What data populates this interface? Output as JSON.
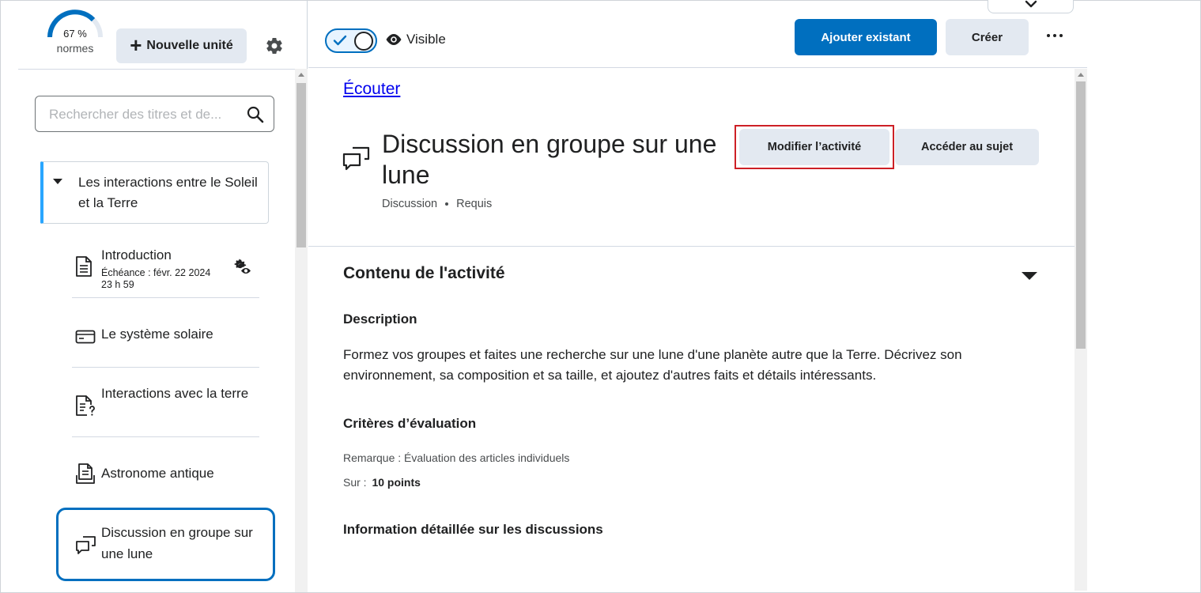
{
  "progress": {
    "percent_text": "67 %",
    "label": "normes",
    "fraction": 0.67
  },
  "toolbar_left": {
    "new_unit_label": "Nouvelle unité"
  },
  "search": {
    "placeholder": "Rechercher des titres et de..."
  },
  "unit": {
    "title": "Les interactions entre le Soleil et la Terre"
  },
  "toc": {
    "items": [
      {
        "title": "Introduction",
        "sub1": "Échéance : févr. 22 2024",
        "sub2": "23 h 59",
        "icon": "document-icon"
      },
      {
        "title": "Le système solaire",
        "icon": "card-icon"
      },
      {
        "title": "Interactions avec la terre",
        "icon": "quiz-icon"
      },
      {
        "title": "Astronome antique",
        "icon": "assignment-icon"
      },
      {
        "title": "Discussion en groupe sur une lune",
        "icon": "discussion-icon"
      }
    ]
  },
  "topbar": {
    "visibility_label": "Visible",
    "visibility_on": true,
    "add_existing_label": "Ajouter existant",
    "create_label": "Créer"
  },
  "activity": {
    "listen_link": "Écouter",
    "title": "Discussion en groupe sur une lune",
    "type": "Discussion",
    "requirement": "Requis",
    "edit_label": "Modifier l’activité",
    "goto_label": "Accéder au sujet"
  },
  "details": {
    "section_title": "Contenu de l'activité",
    "description_heading": "Description",
    "description_text": "Formez vos groupes et faites une recherche sur une lune d'une planète autre que la Terre. Décrivez son environnement, sa composition et sa taille, et ajoutez d'autres faits et détails intéressants.",
    "criteria_heading": "Critères d’évaluation",
    "remark": "Remarque : Évaluation des articles individuels",
    "out_of_label": "Sur :",
    "out_of_value": "10 points",
    "info_heading": "Information détaillée sur les discussions"
  },
  "colors": {
    "primary": "#006fbf",
    "highlight": "#cd2026",
    "accent_bar": "#29a6ff",
    "button_bg": "#e3e9f1"
  }
}
